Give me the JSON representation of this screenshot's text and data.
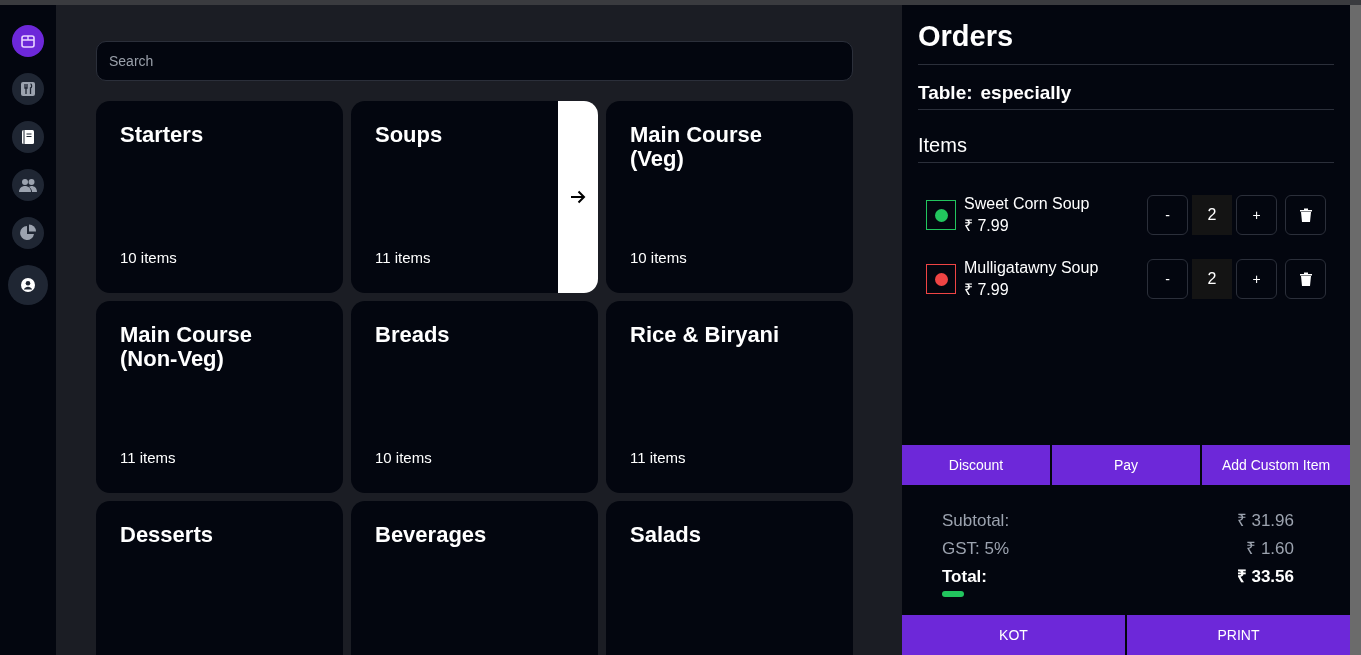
{
  "sidebar": {
    "items": [
      {
        "selected": true
      },
      {
        "selected": false
      },
      {
        "selected": false
      },
      {
        "selected": false
      },
      {
        "selected": false
      },
      {
        "selected": false
      }
    ]
  },
  "search": {
    "placeholder": "Search"
  },
  "categories": [
    {
      "name": "Starters",
      "count": "10 items",
      "hovered": false
    },
    {
      "name": "Soups",
      "count": "11 items",
      "hovered": true
    },
    {
      "name": "Main Course (Veg)",
      "count": "10 items",
      "hovered": false
    },
    {
      "name": "Main Course (Non-Veg)",
      "count": "11 items",
      "hovered": false
    },
    {
      "name": "Breads",
      "count": "10 items",
      "hovered": false
    },
    {
      "name": "Rice & Biryani",
      "count": "11 items",
      "hovered": false
    },
    {
      "name": "Desserts",
      "hovered": false
    },
    {
      "name": "Beverages",
      "hovered": false
    },
    {
      "name": "Salads",
      "hovered": false
    }
  ],
  "orders": {
    "title": "Orders",
    "table_label": "Table:",
    "table_value": "especially",
    "items_heading": "Items",
    "items": [
      {
        "name": "Sweet Corn Soup",
        "price": "₹ 7.99",
        "color": "#22c55e",
        "minus": "-",
        "quantity": "2",
        "plus": "+"
      },
      {
        "name": "Mulligatawny Soup",
        "price": "₹ 7.99",
        "color": "#ef4444",
        "minus": "-",
        "quantity": "2",
        "plus": "+"
      }
    ],
    "actions": [
      "Discount",
      "Pay",
      "Add Custom Item"
    ],
    "summary": [
      {
        "label": "Subtotal:",
        "value": "₹ 31.96",
        "kind": "muted"
      },
      {
        "label": "GST: 5%",
        "value": "₹ 1.60",
        "kind": "muted"
      },
      {
        "label": "Total:",
        "value": "₹ 33.56",
        "kind": "total"
      }
    ],
    "footer_buttons": [
      "KOT",
      "PRINT"
    ]
  }
}
